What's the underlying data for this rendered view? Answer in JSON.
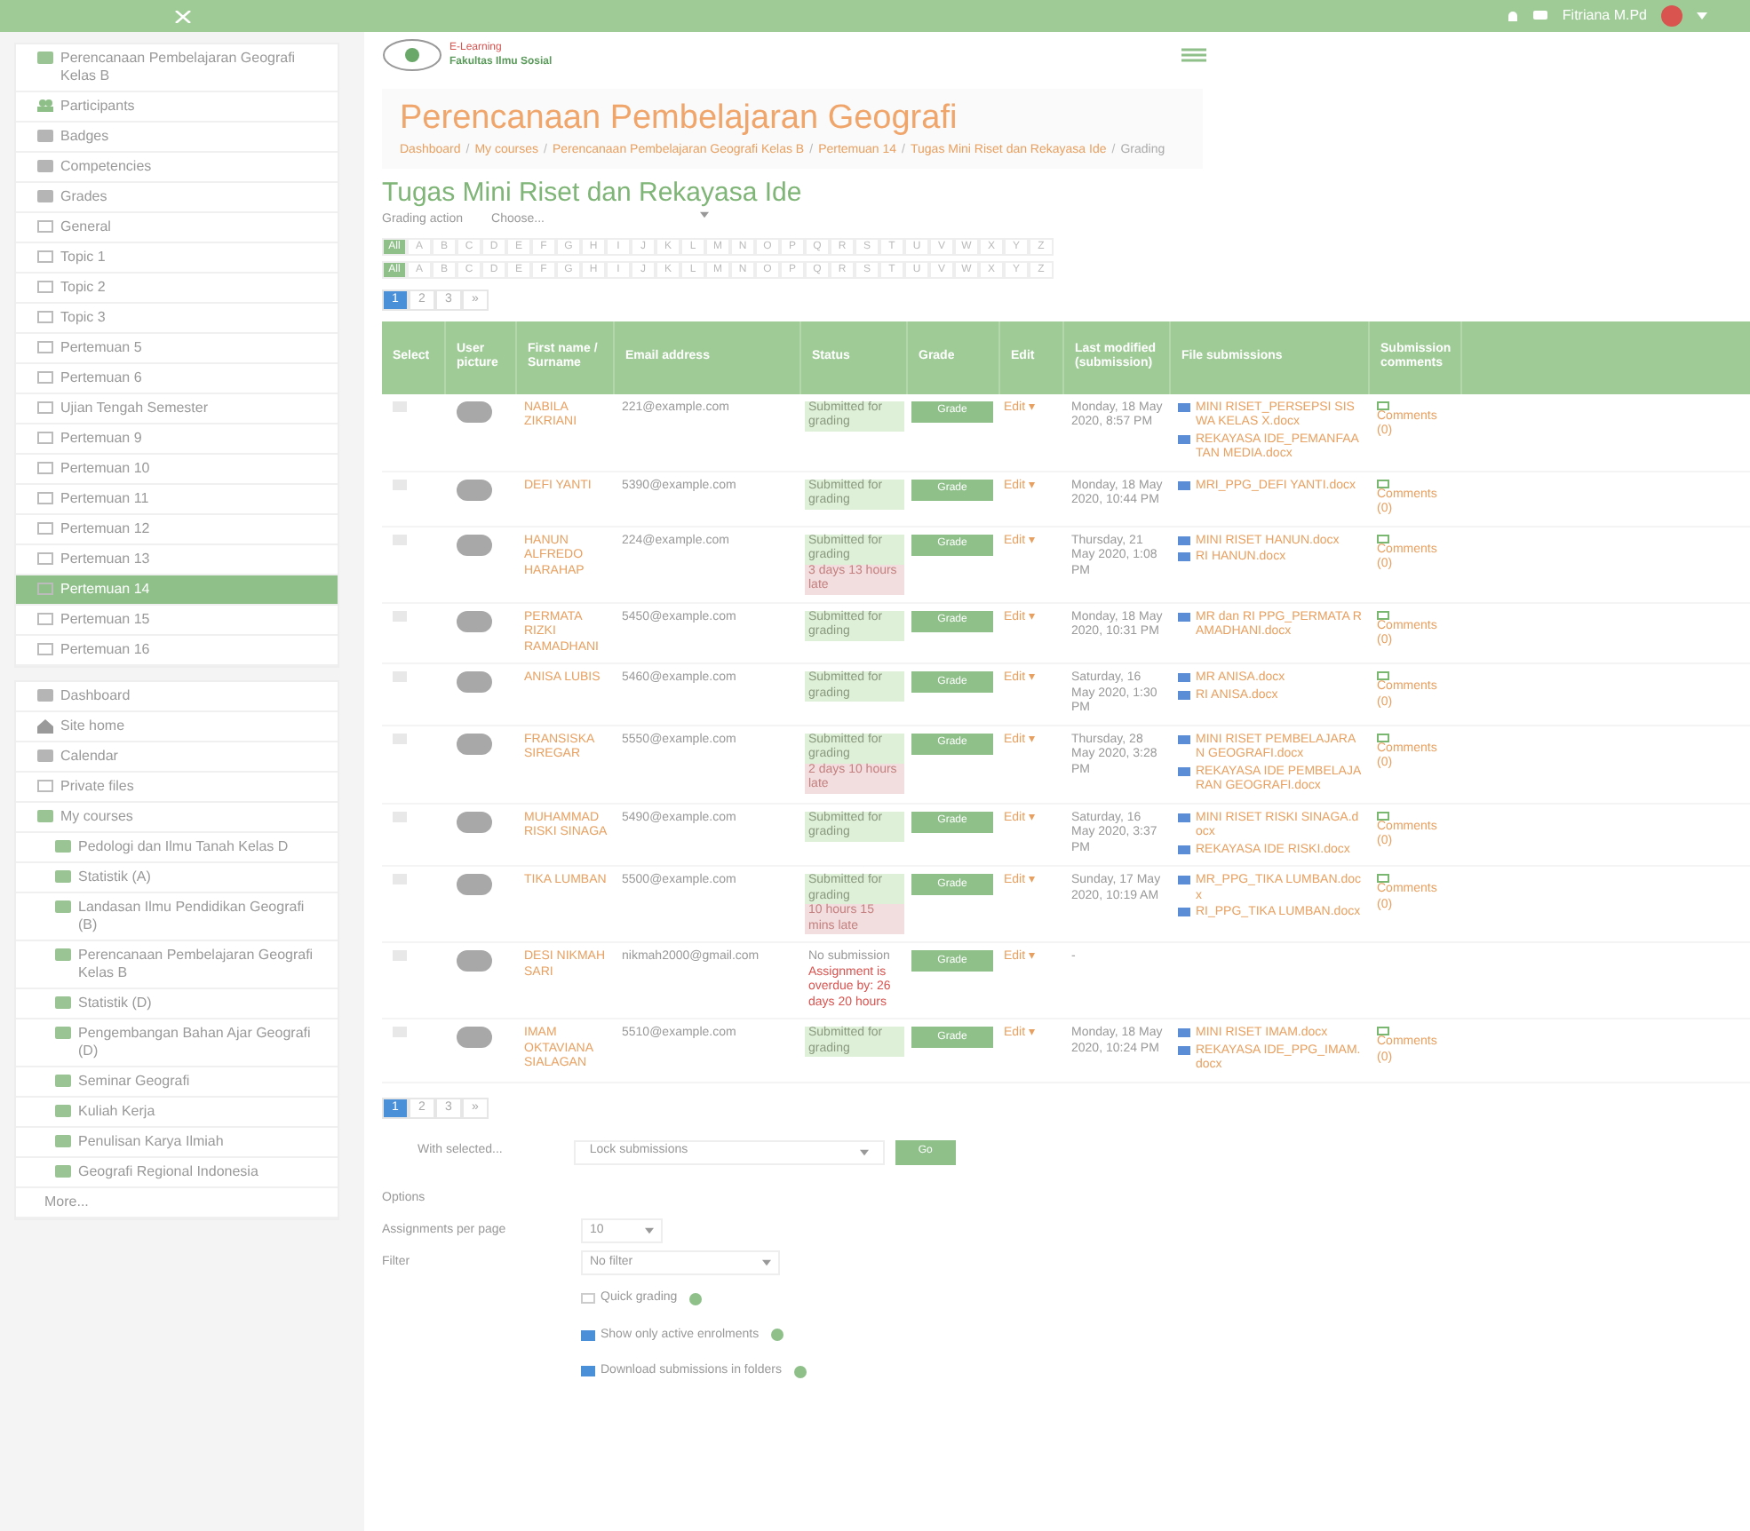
{
  "top_bar": {
    "user_name": "Fitriana M.Pd"
  },
  "sidebar": {
    "groups": [
      {
        "items": [
          {
            "label": "Perencanaan Pembelajaran Geografi Kelas B",
            "kind": "course",
            "selected": false
          },
          {
            "label": "Participants",
            "kind": "people",
            "selected": false
          },
          {
            "label": "Badges",
            "kind": "badge",
            "selected": false
          },
          {
            "label": "Competencies",
            "kind": "check",
            "selected": false
          },
          {
            "label": "Grades",
            "kind": "grid",
            "selected": false
          },
          {
            "label": "General",
            "kind": "folder",
            "selected": false
          },
          {
            "label": "Topic 1",
            "kind": "folder",
            "selected": false
          },
          {
            "label": "Topic 2",
            "kind": "folder",
            "selected": false
          },
          {
            "label": "Topic 3",
            "kind": "folder",
            "selected": false
          },
          {
            "label": "Pertemuan 5",
            "kind": "folder",
            "selected": false
          },
          {
            "label": "Pertemuan 6",
            "kind": "folder",
            "selected": false
          },
          {
            "label": "Ujian Tengah Semester",
            "kind": "folder",
            "selected": false
          },
          {
            "label": "Pertemuan 9",
            "kind": "folder",
            "selected": false
          },
          {
            "label": "Pertemuan 10",
            "kind": "folder",
            "selected": false
          },
          {
            "label": "Pertemuan 11",
            "kind": "folder",
            "selected": false
          },
          {
            "label": "Pertemuan 12",
            "kind": "folder",
            "selected": false
          },
          {
            "label": "Pertemuan 13",
            "kind": "folder",
            "selected": false
          },
          {
            "label": "Pertemuan 14",
            "kind": "folder",
            "selected": true
          },
          {
            "label": "Pertemuan 15",
            "kind": "folder",
            "selected": false
          },
          {
            "label": "Pertemuan 16",
            "kind": "folder",
            "selected": false
          }
        ]
      },
      {
        "items": [
          {
            "label": "Dashboard",
            "kind": "dashboard",
            "selected": false
          },
          {
            "label": "Site home",
            "kind": "home",
            "selected": false
          },
          {
            "label": "Calendar",
            "kind": "grid",
            "selected": false
          },
          {
            "label": "Private files",
            "kind": "folder",
            "selected": false
          },
          {
            "label": "My courses",
            "kind": "course",
            "selected": false
          },
          {
            "label": "Pedologi dan Ilmu Tanah Kelas D",
            "kind": "course",
            "selected": false
          },
          {
            "label": "Statistik (A)",
            "kind": "course",
            "selected": false
          },
          {
            "label": "Landasan Ilmu Pendidikan Geografi (B)",
            "kind": "course",
            "selected": false
          },
          {
            "label": "Perencanaan Pembelajaran Geografi Kelas B",
            "kind": "course",
            "selected": false
          },
          {
            "label": "Statistik (D)",
            "kind": "course",
            "selected": false
          },
          {
            "label": "Pengembangan Bahan Ajar Geografi (D)",
            "kind": "course",
            "selected": false
          },
          {
            "label": "Seminar Geografi",
            "kind": "course",
            "selected": false
          },
          {
            "label": "Kuliah Kerja",
            "kind": "course",
            "selected": false
          },
          {
            "label": "Penulisan Karya Ilmiah",
            "kind": "course",
            "selected": false
          },
          {
            "label": "Geografi Regional Indonesia",
            "kind": "course",
            "selected": false
          },
          {
            "label": "More...",
            "kind": "more",
            "selected": false
          }
        ]
      }
    ]
  },
  "header": {
    "logo_line_1": "E-Learning",
    "logo_line_2": "Fakultas Ilmu Sosial",
    "course_title": "Perencanaan Pembelajaran Geografi",
    "breadcrumb": [
      {
        "label": "Dashboard"
      },
      {
        "separator": "/",
        "label": "My courses"
      },
      {
        "separator": "/",
        "label": "Perencanaan Pembelajaran Geografi Kelas B"
      },
      {
        "separator": "/",
        "label": "Pertemuan 14"
      },
      {
        "separator": "/",
        "label": "Tugas Mini Riset dan Rekayasa Ide"
      },
      {
        "separator": "/",
        "label": "Grading"
      }
    ]
  },
  "assignment_title": "Tugas Mini Riset dan Rekayasa Ide",
  "grading_action": {
    "label": "Grading action",
    "value": "Choose..."
  },
  "initials_rows": [
    [
      "All",
      "A",
      "B",
      "C",
      "D",
      "E",
      "F",
      "G",
      "H",
      "I",
      "J",
      "K",
      "L",
      "M",
      "N",
      "O",
      "P",
      "Q",
      "R",
      "S",
      "T",
      "U",
      "V",
      "W",
      "X",
      "Y",
      "Z"
    ],
    [
      "All",
      "A",
      "B",
      "C",
      "D",
      "E",
      "F",
      "G",
      "H",
      "I",
      "J",
      "K",
      "L",
      "M",
      "N",
      "O",
      "P",
      "Q",
      "R",
      "S",
      "T",
      "U",
      "V",
      "W",
      "X",
      "Y",
      "Z"
    ]
  ],
  "paging_top": [
    {
      "label": "1",
      "selected": true
    },
    {
      "label": "2",
      "selected": false
    },
    {
      "label": "3",
      "selected": false
    },
    {
      "label": "»",
      "selected": false
    }
  ],
  "table": {
    "columns": [
      "Select",
      "User picture",
      "First name / Surname",
      "Email address",
      "Status",
      "Grade",
      "Edit",
      "Last modified (submission)",
      "File submissions",
      "Submission comments"
    ],
    "rows": [
      {
        "name": "NABILA ZIKRIANI",
        "email": "221@example.com",
        "status": [
          {
            "text": "Submitted for grading",
            "kind": "ok"
          }
        ],
        "modified": "Monday, 18 May 2020, 8:57 PM",
        "files": [
          "MINI RISET_PERSEPSI SISWA KELAS X.docx",
          "REKAYASA IDE_PEMANFAATAN MEDIA.docx"
        ],
        "comments": "Comments (0)"
      },
      {
        "name": "DEFI YANTI",
        "email": "5390@example.com",
        "status": [
          {
            "text": "Submitted for grading",
            "kind": "ok"
          }
        ],
        "modified": "Monday, 18 May 2020, 10:44 PM",
        "files": [
          "MRI_PPG_DEFI YANTI.docx"
        ],
        "comments": "Comments (0)"
      },
      {
        "name": "HANUN ALFREDO HARAHAP",
        "email": "224@example.com",
        "status": [
          {
            "text": "Submitted for grading",
            "kind": "ok"
          },
          {
            "text": "3 days 13 hours late",
            "kind": "late"
          }
        ],
        "modified": "Thursday, 21 May 2020, 1:08 PM",
        "files": [
          "MINI RISET HANUN.docx",
          "RI HANUN.docx"
        ],
        "comments": "Comments (0)"
      },
      {
        "name": "PERMATA RIZKI RAMADHANI",
        "email": "5450@example.com",
        "status": [
          {
            "text": "Submitted for grading",
            "kind": "ok"
          }
        ],
        "modified": "Monday, 18 May 2020, 10:31 PM",
        "files": [
          "MR dan RI PPG_PERMATA RAMADHANI.docx"
        ],
        "comments": "Comments (0)"
      },
      {
        "name": "ANISA LUBIS",
        "email": "5460@example.com",
        "status": [
          {
            "text": "Submitted for grading",
            "kind": "ok"
          }
        ],
        "modified": "Saturday, 16 May 2020, 1:30 PM",
        "files": [
          "MR ANISA.docx",
          "RI ANISA.docx"
        ],
        "comments": "Comments (0)"
      },
      {
        "name": "FRANSISKA SIREGAR",
        "email": "5550@example.com",
        "status": [
          {
            "text": "Submitted for grading",
            "kind": "ok"
          },
          {
            "text": "2 days 10 hours late",
            "kind": "late"
          }
        ],
        "modified": "Thursday, 28 May 2020, 3:28 PM",
        "files": [
          "MINI RISET PEMBELAJARAN GEOGRAFI.docx",
          "REKAYASA IDE PEMBELAJARAN GEOGRAFI.docx"
        ],
        "comments": "Comments (0)"
      },
      {
        "name": "MUHAMMAD RISKI SINAGA",
        "email": "5490@example.com",
        "status": [
          {
            "text": "Submitted for grading",
            "kind": "ok"
          }
        ],
        "modified": "Saturday, 16 May 2020, 3:37 PM",
        "files": [
          "MINI RISET RISKI SINAGA.docx",
          "REKAYASA IDE RISKI.docx"
        ],
        "comments": "Comments (0)"
      },
      {
        "name": "TIKA LUMBAN",
        "email": "5500@example.com",
        "status": [
          {
            "text": "Submitted for grading",
            "kind": "ok"
          },
          {
            "text": "10 hours 15 mins late",
            "kind": "late"
          }
        ],
        "modified": "Sunday, 17 May 2020, 10:19 AM",
        "files": [
          "MR_PPG_TIKA LUMBAN.docx",
          "RI_PPG_TIKA LUMBAN.docx"
        ],
        "comments": "Comments (0)"
      },
      {
        "name": "DESI NIKMAH SARI",
        "email": "nikmah2000@gmail.com",
        "status": [
          {
            "text": "No submission",
            "kind": "plain"
          },
          {
            "text": "Assignment is overdue by: 26 days 20 hours",
            "kind": "overdue"
          }
        ],
        "modified": "-",
        "files": [],
        "comments": ""
      },
      {
        "name": "IMAM OKTAVIANA SIALAGAN",
        "email": "5510@example.com",
        "status": [
          {
            "text": "Submitted for grading",
            "kind": "ok"
          }
        ],
        "modified": "Monday, 18 May 2020, 10:24 PM",
        "files": [
          "MINI RISET IMAM.docx",
          "REKAYASA IDE_PPG_IMAM.docx"
        ],
        "comments": "Comments (0)"
      }
    ],
    "grade_buttons": [
      "Grade",
      "Grade",
      "Grade",
      "Grade",
      "Grade",
      "Grade",
      "Grade",
      "Grade",
      "Grade",
      "Grade"
    ],
    "edit_labels": [
      "Edit ▾",
      "Edit ▾",
      "Edit ▾",
      "Edit ▾",
      "Edit ▾",
      "Edit ▾",
      "Edit ▾",
      "Edit ▾",
      "Edit ▾",
      "Edit ▾"
    ],
    "row_selected": [
      false,
      false,
      false,
      false,
      false,
      false,
      false,
      false,
      false,
      false
    ]
  },
  "paging_bottom": [
    {
      "label": "1",
      "selected": true
    },
    {
      "label": "2",
      "selected": false
    },
    {
      "label": "3",
      "selected": false
    },
    {
      "label": "»",
      "selected": false
    }
  ],
  "bulk": {
    "label": "With selected...",
    "value": "Lock submissions",
    "button": "Go"
  },
  "options": {
    "heading": "Options",
    "per_page_label": "Assignments per page",
    "per_page": "10",
    "filter_label": "Filter",
    "filter": "No filter",
    "checkboxes": [
      {
        "label": "Quick grading",
        "checked": false
      },
      {
        "label": "Show only active enrolments",
        "checked": true
      },
      {
        "label": "Download submissions in folders",
        "checked": true
      }
    ]
  }
}
